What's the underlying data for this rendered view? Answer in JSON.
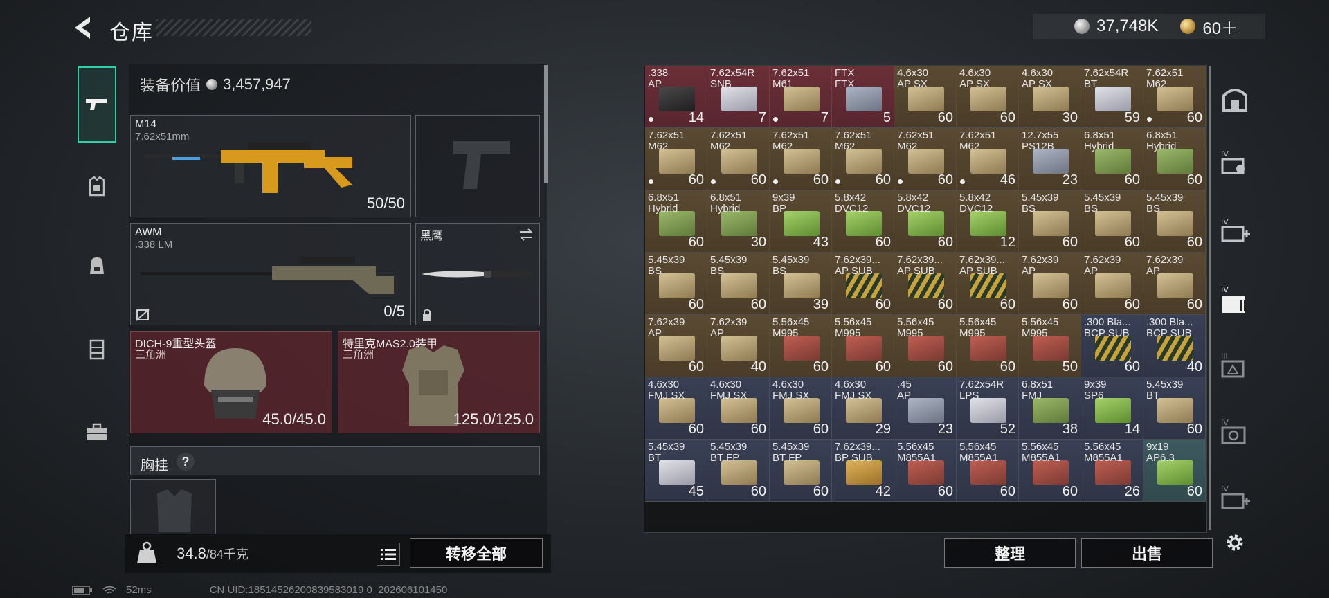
{
  "header": {
    "title": "仓库",
    "silver_amount": "37,748K",
    "gold_amount": "60＋"
  },
  "loadout": {
    "equip_value_label": "装备价值",
    "equip_value": "3,457,947",
    "primary": {
      "name": "M14",
      "caliber": "7.62x51mm",
      "ammo": "50/50"
    },
    "secondary": {
      "name": "AWM",
      "caliber": ".338 LM",
      "ammo": "0/5"
    },
    "melee": {
      "name": "黑鹰"
    },
    "helmet": {
      "name": "DICH-9重型头盔",
      "origin": "三角洲",
      "durability": "45.0/45.0"
    },
    "armor": {
      "name": "特里克MAS2.0装甲",
      "origin": "三角洲",
      "durability": "125.0/125.0"
    },
    "chest_rig": {
      "label": "胸挂",
      "help": "?"
    }
  },
  "footer": {
    "weight_current": "34.8",
    "weight_max": "/84千克",
    "transfer_all": "转移全部",
    "sort": "整理",
    "sell": "出售"
  },
  "status": {
    "ping": "52ms",
    "uid": "CN UID:18514526200839583019 0_202606101450"
  },
  "stash": {
    "rows": [
      [
        {
          "cal": ".338",
          "type": "AP",
          "qty": "14",
          "color": "red",
          "box": "dark",
          "dot": true
        },
        {
          "cal": "7.62x54R",
          "type": "SNB",
          "qty": "7",
          "color": "red",
          "box": "white",
          "dot": false
        },
        {
          "cal": "7.62x51",
          "type": "M61",
          "qty": "7",
          "color": "red",
          "box": "tan",
          "dot": true
        },
        {
          "cal": "FTX",
          "type": "FTX",
          "qty": "5",
          "color": "red",
          "box": "grey",
          "dot": false
        },
        {
          "cal": "4.6x30",
          "type": "AP SX",
          "qty": "60",
          "color": "brown",
          "box": "tan",
          "dot": false
        },
        {
          "cal": "4.6x30",
          "type": "AP SX",
          "qty": "60",
          "color": "brown",
          "box": "tan",
          "dot": false
        },
        {
          "cal": "4.6x30",
          "type": "AP SX",
          "qty": "30",
          "color": "brown",
          "box": "tan",
          "dot": false
        },
        {
          "cal": "7.62x54R",
          "type": "BT",
          "qty": "59",
          "color": "brown",
          "box": "white",
          "dot": false
        },
        {
          "cal": "7.62x51",
          "type": "M62",
          "qty": "60",
          "color": "brown",
          "box": "tan",
          "dot": true
        }
      ],
      [
        {
          "cal": "7.62x51",
          "type": "M62",
          "qty": "60",
          "color": "brown",
          "box": "tan",
          "dot": true
        },
        {
          "cal": "7.62x51",
          "type": "M62",
          "qty": "60",
          "color": "brown",
          "box": "tan",
          "dot": true
        },
        {
          "cal": "7.62x51",
          "type": "M62",
          "qty": "60",
          "color": "brown",
          "box": "tan",
          "dot": true
        },
        {
          "cal": "7.62x51",
          "type": "M62",
          "qty": "60",
          "color": "brown",
          "box": "tan",
          "dot": true
        },
        {
          "cal": "7.62x51",
          "type": "M62",
          "qty": "60",
          "color": "brown",
          "box": "tan",
          "dot": true
        },
        {
          "cal": "7.62x51",
          "type": "M62",
          "qty": "46",
          "color": "brown",
          "box": "tan",
          "dot": true
        },
        {
          "cal": "12.7x55",
          "type": "PS12B",
          "qty": "23",
          "color": "brown",
          "box": "grey",
          "dot": false
        },
        {
          "cal": "6.8x51",
          "type": "Hybrid",
          "qty": "60",
          "color": "brown",
          "box": "green",
          "dot": false
        },
        {
          "cal": "6.8x51",
          "type": "Hybrid",
          "qty": "60",
          "color": "brown",
          "box": "green",
          "dot": false
        }
      ],
      [
        {
          "cal": "6.8x51",
          "type": "Hybrid",
          "qty": "60",
          "color": "brown",
          "box": "green",
          "dot": false
        },
        {
          "cal": "6.8x51",
          "type": "Hybrid",
          "qty": "30",
          "color": "brown",
          "box": "green",
          "dot": false
        },
        {
          "cal": "9x39",
          "type": "BP",
          "qty": "43",
          "color": "brown",
          "box": "lime",
          "dot": false
        },
        {
          "cal": "5.8x42",
          "type": "DVC12",
          "qty": "60",
          "color": "brown",
          "box": "lime",
          "dot": false
        },
        {
          "cal": "5.8x42",
          "type": "DVC12",
          "qty": "60",
          "color": "brown",
          "box": "lime",
          "dot": false
        },
        {
          "cal": "5.8x42",
          "type": "DVC12",
          "qty": "12",
          "color": "brown",
          "box": "lime",
          "dot": false
        },
        {
          "cal": "5.45x39",
          "type": "BS",
          "qty": "60",
          "color": "brown",
          "box": "tan",
          "dot": false
        },
        {
          "cal": "5.45x39",
          "type": "BS",
          "qty": "60",
          "color": "brown",
          "box": "tan",
          "dot": false
        },
        {
          "cal": "5.45x39",
          "type": "BS",
          "qty": "60",
          "color": "brown",
          "box": "tan",
          "dot": false
        }
      ],
      [
        {
          "cal": "5.45x39",
          "type": "BS",
          "qty": "60",
          "color": "brown",
          "box": "tan",
          "dot": false
        },
        {
          "cal": "5.45x39",
          "type": "BS",
          "qty": "60",
          "color": "brown",
          "box": "tan",
          "dot": false
        },
        {
          "cal": "5.45x39",
          "type": "BS",
          "qty": "39",
          "color": "brown",
          "box": "tan",
          "dot": false
        },
        {
          "cal": "7.62x39...",
          "type": "AP SUB",
          "qty": "60",
          "color": "brown",
          "box": "shells",
          "dot": false
        },
        {
          "cal": "7.62x39...",
          "type": "AP SUB",
          "qty": "60",
          "color": "brown",
          "box": "shells",
          "dot": false
        },
        {
          "cal": "7.62x39...",
          "type": "AP SUB",
          "qty": "60",
          "color": "brown",
          "box": "shells",
          "dot": false
        },
        {
          "cal": "7.62x39",
          "type": "AP",
          "qty": "60",
          "color": "brown",
          "box": "tan",
          "dot": false
        },
        {
          "cal": "7.62x39",
          "type": "AP",
          "qty": "60",
          "color": "brown",
          "box": "tan",
          "dot": false
        },
        {
          "cal": "7.62x39",
          "type": "AP",
          "qty": "60",
          "color": "brown",
          "box": "tan",
          "dot": false
        }
      ],
      [
        {
          "cal": "7.62x39",
          "type": "AP",
          "qty": "60",
          "color": "brown",
          "box": "tan",
          "dot": false
        },
        {
          "cal": "7.62x39",
          "type": "AP",
          "qty": "40",
          "color": "brown",
          "box": "tan",
          "dot": false
        },
        {
          "cal": "5.56x45",
          "type": "M995",
          "qty": "60",
          "color": "brown",
          "box": "red",
          "dot": false
        },
        {
          "cal": "5.56x45",
          "type": "M995",
          "qty": "60",
          "color": "brown",
          "box": "red",
          "dot": false
        },
        {
          "cal": "5.56x45",
          "type": "M995",
          "qty": "60",
          "color": "brown",
          "box": "red",
          "dot": false
        },
        {
          "cal": "5.56x45",
          "type": "M995",
          "qty": "60",
          "color": "brown",
          "box": "red",
          "dot": false
        },
        {
          "cal": "5.56x45",
          "type": "M995",
          "qty": "50",
          "color": "brown",
          "box": "red",
          "dot": false
        },
        {
          "cal": ".300 Bla...",
          "type": "BCP SUB",
          "qty": "60",
          "color": "blue",
          "box": "shells",
          "dot": false
        },
        {
          "cal": ".300 Bla...",
          "type": "BCP SUB",
          "qty": "40",
          "color": "blue",
          "box": "shells",
          "dot": false
        }
      ],
      [
        {
          "cal": "4.6x30",
          "type": "FMJ SX",
          "qty": "60",
          "color": "blue",
          "box": "tan",
          "dot": false
        },
        {
          "cal": "4.6x30",
          "type": "FMJ SX",
          "qty": "60",
          "color": "blue",
          "box": "tan",
          "dot": false
        },
        {
          "cal": "4.6x30",
          "type": "FMJ SX",
          "qty": "60",
          "color": "blue",
          "box": "tan",
          "dot": false
        },
        {
          "cal": "4.6x30",
          "type": "FMJ SX",
          "qty": "29",
          "color": "blue",
          "box": "tan",
          "dot": false
        },
        {
          "cal": ".45",
          "type": "AP",
          "qty": "23",
          "color": "blue",
          "box": "grey",
          "dot": false
        },
        {
          "cal": "7.62x54R",
          "type": "LPS",
          "qty": "52",
          "color": "blue",
          "box": "white",
          "dot": false
        },
        {
          "cal": "6.8x51",
          "type": "FMJ",
          "qty": "38",
          "color": "blue",
          "box": "green",
          "dot": false
        },
        {
          "cal": "9x39",
          "type": "SP6",
          "qty": "14",
          "color": "blue",
          "box": "lime",
          "dot": false
        },
        {
          "cal": "5.45x39",
          "type": "BT",
          "qty": "60",
          "color": "blue",
          "box": "tan",
          "dot": false
        }
      ],
      [
        {
          "cal": "5.45x39",
          "type": "BT",
          "qty": "45",
          "color": "blue",
          "box": "white",
          "dot": false
        },
        {
          "cal": "5.45x39",
          "type": "BT FP",
          "qty": "60",
          "color": "blue",
          "box": "tan",
          "dot": false
        },
        {
          "cal": "5.45x39",
          "type": "BT FP",
          "qty": "60",
          "color": "blue",
          "box": "tan",
          "dot": false
        },
        {
          "cal": "7.62x39...",
          "type": "BP SUB",
          "qty": "42",
          "color": "blue",
          "box": "gold",
          "dot": false
        },
        {
          "cal": "5.56x45",
          "type": "M855A1",
          "qty": "60",
          "color": "blue",
          "box": "red",
          "dot": false
        },
        {
          "cal": "5.56x45",
          "type": "M855A1",
          "qty": "60",
          "color": "blue",
          "box": "red",
          "dot": false
        },
        {
          "cal": "5.56x45",
          "type": "M855A1",
          "qty": "60",
          "color": "blue",
          "box": "red",
          "dot": false
        },
        {
          "cal": "5.56x45",
          "type": "M855A1",
          "qty": "26",
          "color": "blue",
          "box": "red",
          "dot": false
        },
        {
          "cal": "9x19",
          "type": "AP6.3",
          "qty": "60",
          "color": "teal",
          "box": "lime",
          "dot": false
        }
      ]
    ]
  }
}
